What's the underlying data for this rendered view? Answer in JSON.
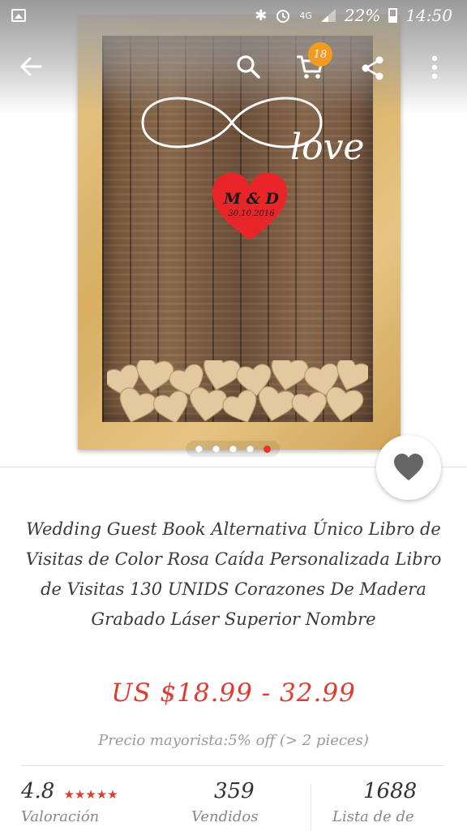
{
  "status_bar": {
    "time": "14:50",
    "battery": "22%",
    "network": "4G"
  },
  "header": {
    "cart_count": "18"
  },
  "product_image": {
    "script_word": "love",
    "heart_initials": "M & D",
    "heart_date": "30.10.2016",
    "carousel": {
      "total": 5,
      "active_index": 4
    }
  },
  "product": {
    "title": "Wedding Guest Book Alternativa Único Libro de Visitas de Color Rosa Caída Personalizada Libro de Visitas 130 UNIDS Corazones De Madera Grabado Láser Superior Nombre",
    "price": "US $18.99 - 32.99",
    "wholesale": "Precio mayorista:5% off (> 2 pieces)"
  },
  "stats": {
    "rating": "4.8",
    "rating_stars": "★★★★★",
    "rating_label": "Valoración",
    "sold": "359",
    "sold_label": "Vendidos",
    "wishlist": "1688",
    "wishlist_label": "Lista de de"
  },
  "colors": {
    "accent": "#e23b2e",
    "badge": "#f39b1e"
  }
}
